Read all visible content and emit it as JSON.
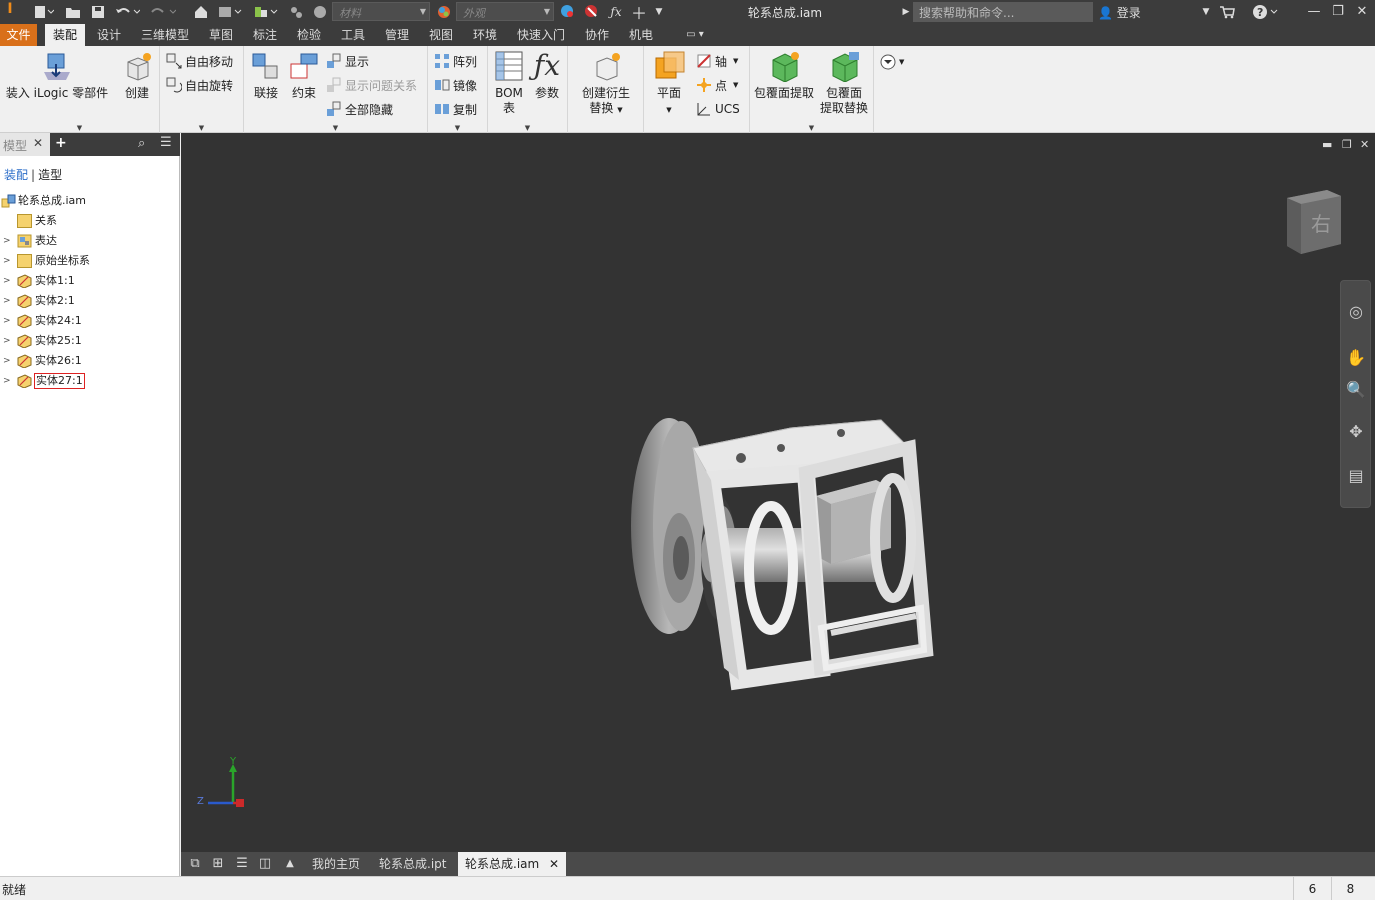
{
  "titlebar": {
    "material_placeholder": "材料",
    "appearance_placeholder": "外观",
    "doc_title": "轮系总成.iam",
    "search_placeholder": "搜索帮助和命令...",
    "login": "登录"
  },
  "menu": {
    "tabs": [
      "文件",
      "装配",
      "设计",
      "三维模型",
      "草图",
      "标注",
      "检验",
      "工具",
      "管理",
      "视图",
      "环境",
      "快速入门",
      "协作",
      "机电"
    ],
    "active": "装配"
  },
  "ribbon": {
    "place_label": "装入",
    "ilogic_label": "iLogic 零部件",
    "create_label": "创建",
    "free_move": "自由移动",
    "free_rotate": "自由旋转",
    "joint": "联接",
    "constrain": "约束",
    "show": "显示",
    "show_sick": "显示问题关系",
    "hide_all": "全部隐藏",
    "pattern": "阵列",
    "mirror": "镜像",
    "copy": "复制",
    "bom_line1": "BOM",
    "bom_line2": "表",
    "params": "参数",
    "derive_line1": "创建衍生",
    "derive_line2": "替换",
    "plane": "平面",
    "axis": "轴",
    "point": "点",
    "ucs": "UCS",
    "shrinkwrap": "包覆面提取",
    "shrinkwrap_sub_line1": "包覆面",
    "shrinkwrap_sub_line2": "提取替换"
  },
  "browser": {
    "tab_label": "模型",
    "mode_assembly": "装配",
    "mode_modeling": "造型",
    "root": "轮系总成.iam",
    "items": [
      {
        "label": "关系",
        "type": "folder",
        "expandable": false
      },
      {
        "label": "表达",
        "type": "repr",
        "expandable": true
      },
      {
        "label": "原始坐标系",
        "type": "folder",
        "expandable": true
      },
      {
        "label": "实体1:1",
        "type": "part",
        "expandable": true
      },
      {
        "label": "实体2:1",
        "type": "part",
        "expandable": true
      },
      {
        "label": "实体24:1",
        "type": "part",
        "expandable": true
      },
      {
        "label": "实体25:1",
        "type": "part",
        "expandable": true
      },
      {
        "label": "实体26:1",
        "type": "part",
        "expandable": true
      },
      {
        "label": "实体27:1",
        "type": "part",
        "expandable": true,
        "selected": true
      }
    ]
  },
  "viewport": {
    "viewcube_face": "右",
    "triad_y": "Y",
    "triad_z": "Z"
  },
  "doctabs": {
    "home": "我的主页",
    "tab_ipt": "轮系总成.ipt",
    "tab_iam": "轮系总成.iam",
    "close": "✕"
  },
  "status": {
    "text": "就绪",
    "count1": "6",
    "count2": "8"
  },
  "colors": {
    "accent_file": "#d9701a",
    "titlebar_bg": "#3c3c3c",
    "viewport_bg": "#333333",
    "selected_outline": "#dd2222"
  }
}
